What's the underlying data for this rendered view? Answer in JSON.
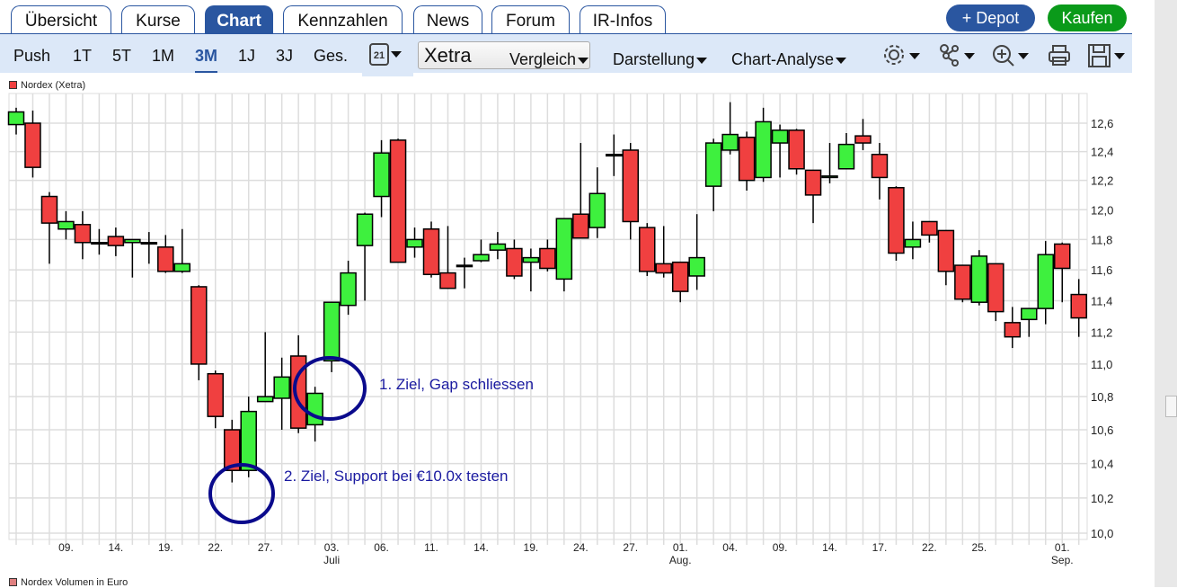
{
  "tabs": [
    {
      "label": "Übersicht"
    },
    {
      "label": "Kurse"
    },
    {
      "label": "Chart",
      "active": true
    },
    {
      "label": "Kennzahlen"
    },
    {
      "label": "News"
    },
    {
      "label": "Forum"
    },
    {
      "label": "IR-Infos"
    }
  ],
  "actions": {
    "depot": "+ Depot",
    "kaufen": "Kaufen",
    "depot_color": "#2a56a0",
    "kaufen_color": "#0a9a1a"
  },
  "toolbar": {
    "periods": [
      {
        "label": "Push"
      },
      {
        "label": "1T"
      },
      {
        "label": "5T"
      },
      {
        "label": "1M"
      },
      {
        "label": "3M",
        "active": true
      },
      {
        "label": "1J"
      },
      {
        "label": "3J"
      },
      {
        "label": "Ges."
      }
    ],
    "calendar_day": "21",
    "exchange": "Xetra",
    "vergleich": "Vergleich",
    "darstellung": "Darstellung",
    "analyse": "Chart-Analyse",
    "icons": [
      "gear-icon",
      "indicators-icon",
      "zoom-icon",
      "print-icon",
      "save-icon"
    ]
  },
  "legend": {
    "price": "Nordex (Xetra)",
    "volume": "Nordex Volumen in Euro"
  },
  "annotations": {
    "a1": "1. Ziel, Gap schliessen",
    "a2": "2. Ziel, Support bei €10.0x testen"
  },
  "chart_data": {
    "type": "candlestick",
    "yscale": "log",
    "ylim": [
      10.0,
      12.7
    ],
    "yticks": [
      "10,0",
      "10,2",
      "10,4",
      "10,6",
      "10,8",
      "11,0",
      "11,2",
      "11,4",
      "11,6",
      "11,8",
      "12,0",
      "12,2",
      "12,4",
      "12,6"
    ],
    "ytick_values": [
      10.0,
      10.2,
      10.4,
      10.6,
      10.8,
      11.0,
      11.2,
      11.4,
      11.6,
      11.8,
      12.0,
      12.2,
      12.4,
      12.6
    ],
    "xticks": [
      {
        "i": 3,
        "label": "09."
      },
      {
        "i": 6,
        "label": "14."
      },
      {
        "i": 9,
        "label": "19."
      },
      {
        "i": 12,
        "label": "22."
      },
      {
        "i": 15,
        "label": "27."
      },
      {
        "i": 19,
        "label": "03.",
        "sub": "Juli"
      },
      {
        "i": 22,
        "label": "06."
      },
      {
        "i": 25,
        "label": "11."
      },
      {
        "i": 28,
        "label": "14."
      },
      {
        "i": 31,
        "label": "19."
      },
      {
        "i": 34,
        "label": "24."
      },
      {
        "i": 37,
        "label": "27."
      },
      {
        "i": 40,
        "label": "01.",
        "sub": "Aug."
      },
      {
        "i": 43,
        "label": "04."
      },
      {
        "i": 46,
        "label": "09."
      },
      {
        "i": 49,
        "label": "14."
      },
      {
        "i": 52,
        "label": "17."
      },
      {
        "i": 55,
        "label": "22."
      },
      {
        "i": 58,
        "label": "25."
      },
      {
        "i": 63,
        "label": "01.",
        "sub": "Sep."
      }
    ],
    "up_color": "#3ef03e",
    "down_color": "#f04040",
    "ohlc": [
      [
        12.59,
        12.71,
        12.52,
        12.68
      ],
      [
        12.6,
        12.69,
        12.22,
        12.29
      ],
      [
        12.09,
        12.12,
        11.64,
        11.91
      ],
      [
        11.87,
        11.99,
        11.8,
        11.92
      ],
      [
        11.9,
        11.99,
        11.67,
        11.78
      ],
      [
        11.78,
        11.87,
        11.7,
        11.78
      ],
      [
        11.82,
        11.88,
        11.69,
        11.76
      ],
      [
        11.78,
        11.8,
        11.55,
        11.8
      ],
      [
        11.78,
        11.85,
        11.64,
        11.78
      ],
      [
        11.75,
        11.83,
        11.58,
        11.59
      ],
      [
        11.59,
        11.87,
        11.58,
        11.64
      ],
      [
        11.49,
        11.5,
        10.9,
        11.0
      ],
      [
        10.94,
        10.96,
        10.61,
        10.68
      ],
      [
        10.6,
        10.66,
        10.29,
        10.36
      ],
      [
        10.36,
        10.8,
        10.32,
        10.71
      ],
      [
        10.77,
        11.2,
        10.77,
        10.8
      ],
      [
        10.79,
        11.04,
        10.6,
        10.92
      ],
      [
        11.05,
        11.18,
        10.58,
        10.61
      ],
      [
        10.63,
        10.86,
        10.53,
        10.82
      ],
      [
        11.02,
        11.39,
        10.95,
        11.39
      ],
      [
        11.37,
        11.66,
        11.31,
        11.58
      ],
      [
        11.76,
        11.98,
        11.4,
        11.97
      ],
      [
        12.09,
        12.48,
        11.95,
        12.39
      ],
      [
        12.48,
        12.49,
        11.65,
        11.65
      ],
      [
        11.75,
        11.88,
        11.68,
        11.8
      ],
      [
        11.87,
        11.92,
        11.55,
        11.57
      ],
      [
        11.58,
        11.89,
        11.48,
        11.48
      ],
      [
        11.63,
        11.68,
        11.48,
        11.63
      ],
      [
        11.66,
        11.8,
        11.65,
        11.7
      ],
      [
        11.73,
        11.85,
        11.67,
        11.77
      ],
      [
        11.74,
        11.8,
        11.54,
        11.56
      ],
      [
        11.65,
        11.74,
        11.46,
        11.68
      ],
      [
        11.74,
        11.8,
        11.59,
        11.61
      ],
      [
        11.54,
        11.94,
        11.46,
        11.94
      ],
      [
        11.97,
        12.46,
        11.81,
        11.81
      ],
      [
        11.88,
        12.29,
        11.81,
        12.11
      ],
      [
        12.37,
        12.52,
        12.23,
        12.38
      ],
      [
        12.41,
        12.46,
        11.8,
        11.92
      ],
      [
        11.88,
        11.91,
        11.56,
        11.59
      ],
      [
        11.64,
        11.89,
        11.55,
        11.58
      ],
      [
        11.65,
        11.65,
        11.39,
        11.46
      ],
      [
        11.56,
        11.97,
        11.47,
        11.68
      ],
      [
        12.16,
        12.49,
        11.99,
        12.46
      ],
      [
        12.41,
        12.75,
        12.38,
        12.52
      ],
      [
        12.5,
        12.54,
        12.13,
        12.2
      ],
      [
        12.22,
        12.71,
        12.19,
        12.61
      ],
      [
        12.46,
        12.59,
        12.22,
        12.55
      ],
      [
        12.55,
        12.56,
        12.24,
        12.28
      ],
      [
        12.27,
        12.27,
        11.91,
        12.1
      ],
      [
        12.22,
        12.46,
        12.18,
        12.23
      ],
      [
        12.28,
        12.53,
        12.28,
        12.45
      ],
      [
        12.51,
        12.63,
        12.41,
        12.46
      ],
      [
        12.38,
        12.46,
        12.07,
        12.22
      ],
      [
        12.15,
        12.16,
        11.66,
        11.71
      ],
      [
        11.75,
        11.92,
        11.67,
        11.8
      ],
      [
        11.92,
        11.92,
        11.78,
        11.83
      ],
      [
        11.86,
        11.86,
        11.5,
        11.59
      ],
      [
        11.63,
        11.63,
        11.39,
        11.41
      ],
      [
        11.39,
        11.73,
        11.37,
        11.69
      ],
      [
        11.64,
        11.64,
        11.27,
        11.33
      ],
      [
        11.26,
        11.36,
        11.1,
        11.17
      ],
      [
        11.28,
        11.35,
        11.17,
        11.35
      ],
      [
        11.35,
        11.79,
        11.25,
        11.7
      ],
      [
        11.77,
        11.78,
        11.39,
        11.61
      ],
      [
        11.44,
        11.54,
        11.17,
        11.29
      ]
    ]
  }
}
